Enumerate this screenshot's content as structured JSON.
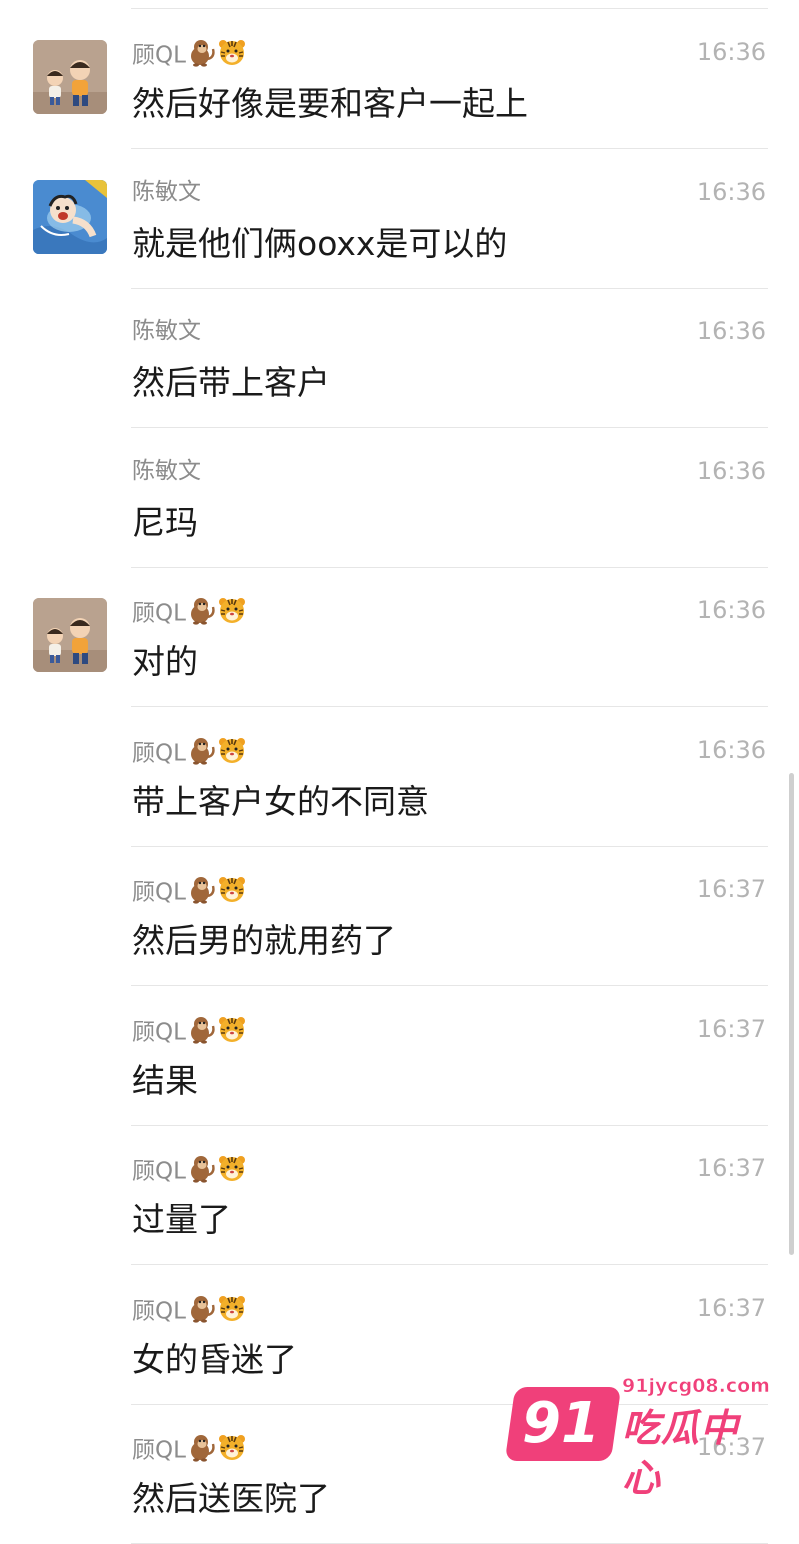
{
  "messages": [
    {
      "sender": "顾QL",
      "emoji": [
        "monkey",
        "tiger"
      ],
      "time": "16:36",
      "text": "然后好像是要和客户一起上",
      "avatar": "gu"
    },
    {
      "sender": "陈敏文",
      "emoji": [],
      "time": "16:36",
      "text": "就是他们俩ooxx是可以的",
      "avatar": "chen"
    },
    {
      "sender": "陈敏文",
      "emoji": [],
      "time": "16:36",
      "text": "然后带上客户",
      "avatar": ""
    },
    {
      "sender": "陈敏文",
      "emoji": [],
      "time": "16:36",
      "text": "尼玛",
      "avatar": ""
    },
    {
      "sender": "顾QL",
      "emoji": [
        "monkey",
        "tiger"
      ],
      "time": "16:36",
      "text": "对的",
      "avatar": "gu"
    },
    {
      "sender": "顾QL",
      "emoji": [
        "monkey",
        "tiger"
      ],
      "time": "16:36",
      "text": "带上客户女的不同意",
      "avatar": ""
    },
    {
      "sender": "顾QL",
      "emoji": [
        "monkey",
        "tiger"
      ],
      "time": "16:37",
      "text": "然后男的就用药了",
      "avatar": ""
    },
    {
      "sender": "顾QL",
      "emoji": [
        "monkey",
        "tiger"
      ],
      "time": "16:37",
      "text": "结果",
      "avatar": ""
    },
    {
      "sender": "顾QL",
      "emoji": [
        "monkey",
        "tiger"
      ],
      "time": "16:37",
      "text": "过量了",
      "avatar": ""
    },
    {
      "sender": "顾QL",
      "emoji": [
        "monkey",
        "tiger"
      ],
      "time": "16:37",
      "text": "女的昏迷了",
      "avatar": ""
    },
    {
      "sender": "顾QL",
      "emoji": [
        "monkey",
        "tiger"
      ],
      "time": "16:37",
      "text": "然后送医院了",
      "avatar": ""
    }
  ],
  "watermark": {
    "number": "91",
    "url": "91jycg08.com",
    "title": "吃瓜中心",
    "color": "#f0407a"
  }
}
